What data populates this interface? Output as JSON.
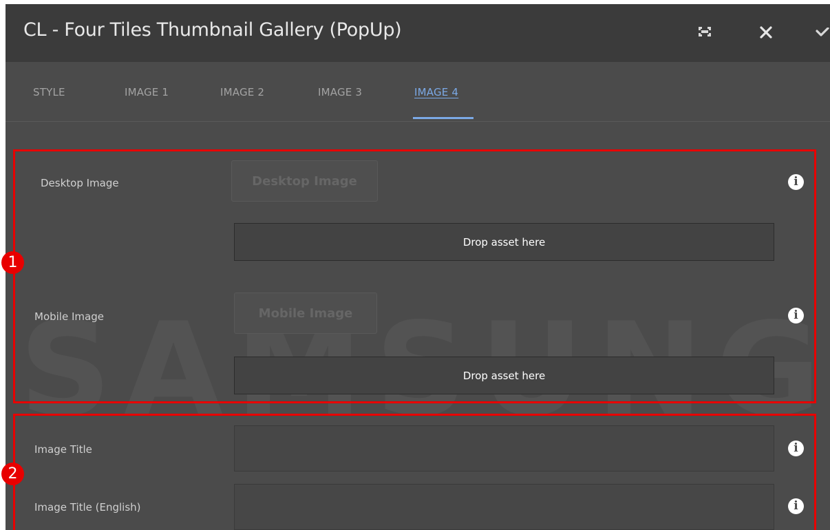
{
  "dialog": {
    "title": "CL - Four Tiles Thumbnail Gallery (PopUp)",
    "icons": [
      "fullscreen-icon",
      "close-icon",
      "check-icon"
    ]
  },
  "tabs": [
    {
      "label": "STYLE",
      "active": false
    },
    {
      "label": "IMAGE 1",
      "active": false
    },
    {
      "label": "IMAGE 2",
      "active": false
    },
    {
      "label": "IMAGE 3",
      "active": false
    },
    {
      "label": "IMAGE 4",
      "active": true
    }
  ],
  "watermark": "SAMSUNG",
  "images": {
    "desktop": {
      "label": "Desktop Image",
      "button": "Desktop Image",
      "drop": "Drop asset here"
    },
    "mobile": {
      "label": "Mobile Image",
      "button": "Mobile Image",
      "drop": "Drop asset here"
    }
  },
  "fields": {
    "title": {
      "label": "Image Title",
      "value": ""
    },
    "title_en": {
      "label": "Image Title (English)",
      "value": ""
    }
  },
  "annotations": [
    "1",
    "2"
  ],
  "colors": {
    "accent": "#7ba9e6",
    "highlight": "#e80000",
    "panel": "#4b4b4b",
    "header": "#3b3b3b"
  }
}
